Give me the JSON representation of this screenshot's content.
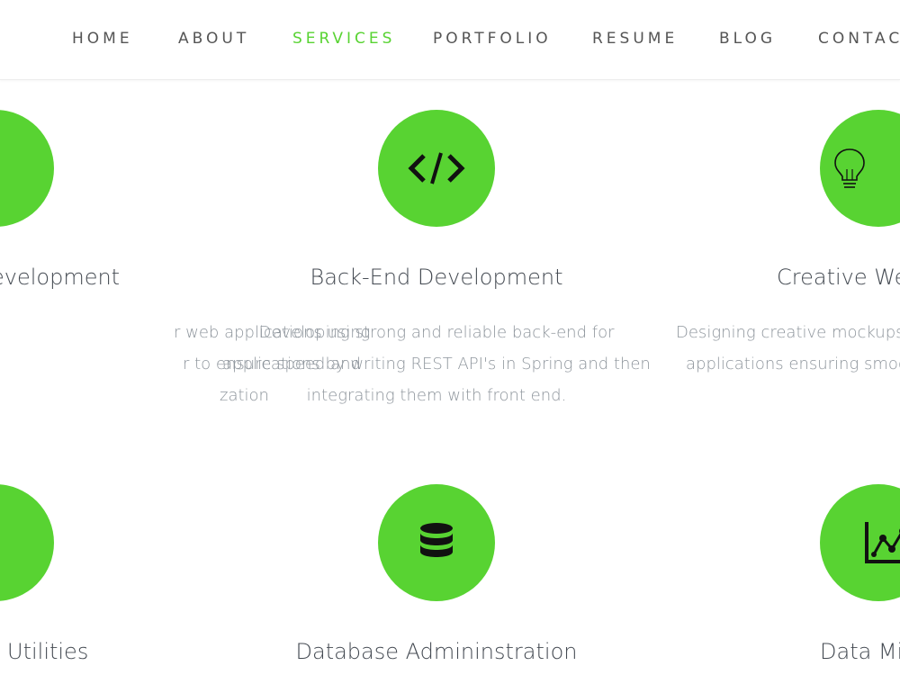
{
  "nav": {
    "items": [
      {
        "label": "HOME",
        "active": false
      },
      {
        "label": "ABOUT",
        "active": false
      },
      {
        "label": "SERVICES",
        "active": true
      },
      {
        "label": "PORTFOLIO",
        "active": false
      },
      {
        "label": "RESUME",
        "active": false
      },
      {
        "label": "BLOG",
        "active": false
      },
      {
        "label": "CONTAC",
        "active": false
      }
    ]
  },
  "colors": {
    "accent": "#58d332",
    "nav_text": "#555555",
    "title_text": "#444a52",
    "desc_text": "#8e959c"
  },
  "services": [
    {
      "icon": "tablet-icon",
      "title": "evelopment",
      "lines": [
        "r web applications using",
        "r to ensure speed and",
        "zation"
      ]
    },
    {
      "icon": "code-icon",
      "title": "Back-End Development",
      "lines": [
        "Developing strong and reliable back-end for",
        "applications by writing REST API's in Spring and then",
        "integrating them with front end."
      ]
    },
    {
      "icon": "lightbulb-icon",
      "title": "Creative Web",
      "lines": [
        "Designing creative mockups a",
        "applications ensuring smoot"
      ]
    },
    {
      "icon": "gear-icon",
      "title": "Utilities",
      "lines": []
    },
    {
      "icon": "database-icon",
      "title": "Database Admininstration",
      "lines": []
    },
    {
      "icon": "chart-icon",
      "title": "Data Mir",
      "lines": []
    }
  ]
}
